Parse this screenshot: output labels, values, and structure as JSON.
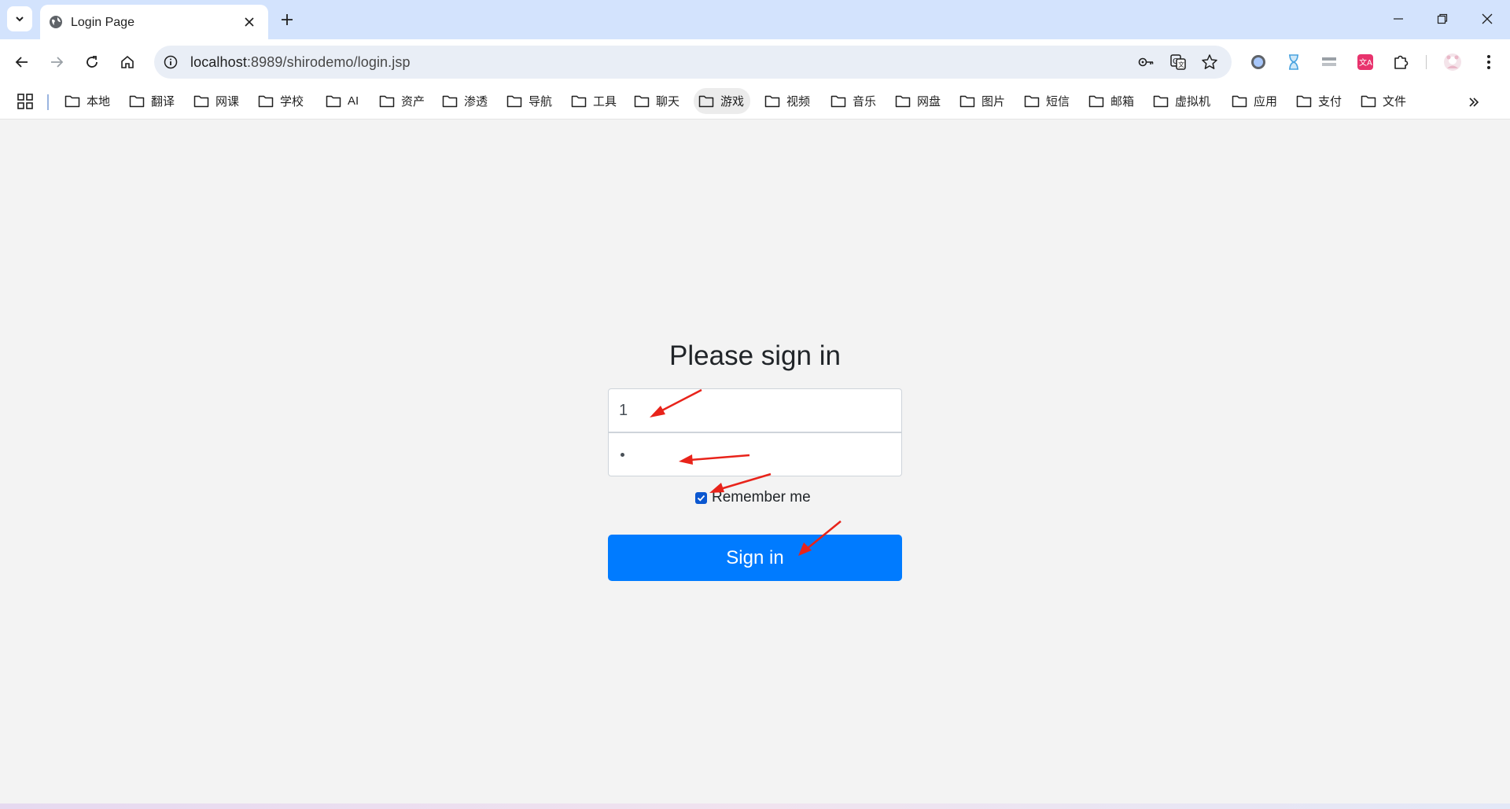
{
  "window": {
    "tab_title": "Login Page",
    "controls": [
      "minimize",
      "restore",
      "close"
    ]
  },
  "toolbar": {
    "url_host": "localhost",
    "url_rest": ":8989/shirodemo/login.jsp"
  },
  "bookmarks": [
    {
      "label": "本地"
    },
    {
      "label": "翻译"
    },
    {
      "label": "网课"
    },
    {
      "label": "学校"
    },
    {
      "label": "AI"
    },
    {
      "label": "资产"
    },
    {
      "label": "渗透"
    },
    {
      "label": "导航"
    },
    {
      "label": "工具"
    },
    {
      "label": "聊天"
    },
    {
      "label": "游戏"
    },
    {
      "label": "视频"
    },
    {
      "label": "音乐"
    },
    {
      "label": "网盘"
    },
    {
      "label": "图片"
    },
    {
      "label": "短信"
    },
    {
      "label": "邮箱"
    },
    {
      "label": "虚拟机"
    },
    {
      "label": "应用"
    },
    {
      "label": "支付"
    },
    {
      "label": "文件"
    }
  ],
  "form": {
    "heading": "Please sign in",
    "username_value": "1",
    "password_masked": "•",
    "remember_label": "Remember me",
    "remember_checked": true,
    "submit_label": "Sign in"
  },
  "colors": {
    "primary_button": "#007bff",
    "tabstrip": "#d3e3fd",
    "annotation_arrow": "#e8231a",
    "page_bg": "#f3f3f3"
  }
}
